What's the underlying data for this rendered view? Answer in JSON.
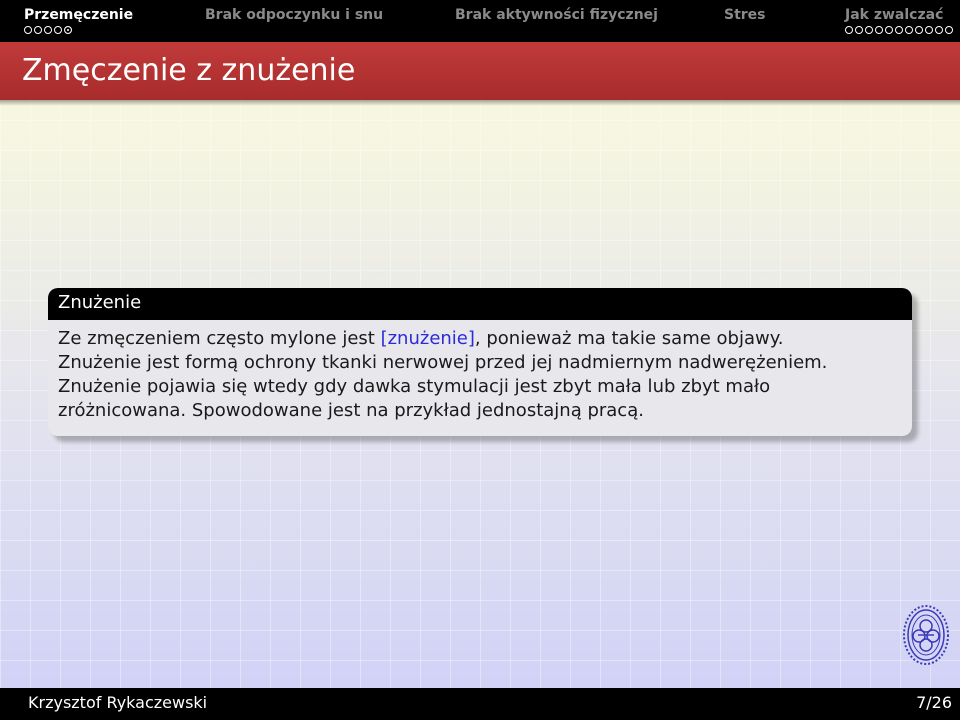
{
  "nav": {
    "sections": [
      {
        "label": "Przemęczenie",
        "active": true,
        "dots": 5,
        "current_dot": 5
      },
      {
        "label": "Brak odpoczynku i snu",
        "active": false,
        "dots": 0
      },
      {
        "label": "Brak aktywności fizycznej",
        "active": false,
        "dots": 0
      },
      {
        "label": "Stres",
        "active": false,
        "dots": 0
      },
      {
        "label": "Jak zwalczać",
        "active": false,
        "dots": 11
      }
    ]
  },
  "frame": {
    "title": "Zmęczenie z znużenie"
  },
  "block": {
    "title": "Znużenie",
    "line1_pre": "Ze zmęczeniem często mylone jest ",
    "line1_link": "[znużenie]",
    "line1_post": ", ponieważ ma takie same objawy.",
    "line2": "Znużenie jest formą ochrony tkanki nerwowej przed jej nadmiernym nadwerężeniem.",
    "line3": "Znużenie pojawia się wtedy gdy dawka stymulacji jest zbyt mała lub zbyt mało",
    "line4": "zróżnicowana. Spowodowane jest na przykład jednostajną pracą."
  },
  "footer": {
    "author": "Krzysztof Rykaczewski",
    "page": "7/26"
  },
  "colors": {
    "title_bar": "#b33232",
    "link": "#2b2bd8",
    "seal": "#3a3ab8"
  },
  "icons": {
    "seal": "university-seal-icon"
  }
}
